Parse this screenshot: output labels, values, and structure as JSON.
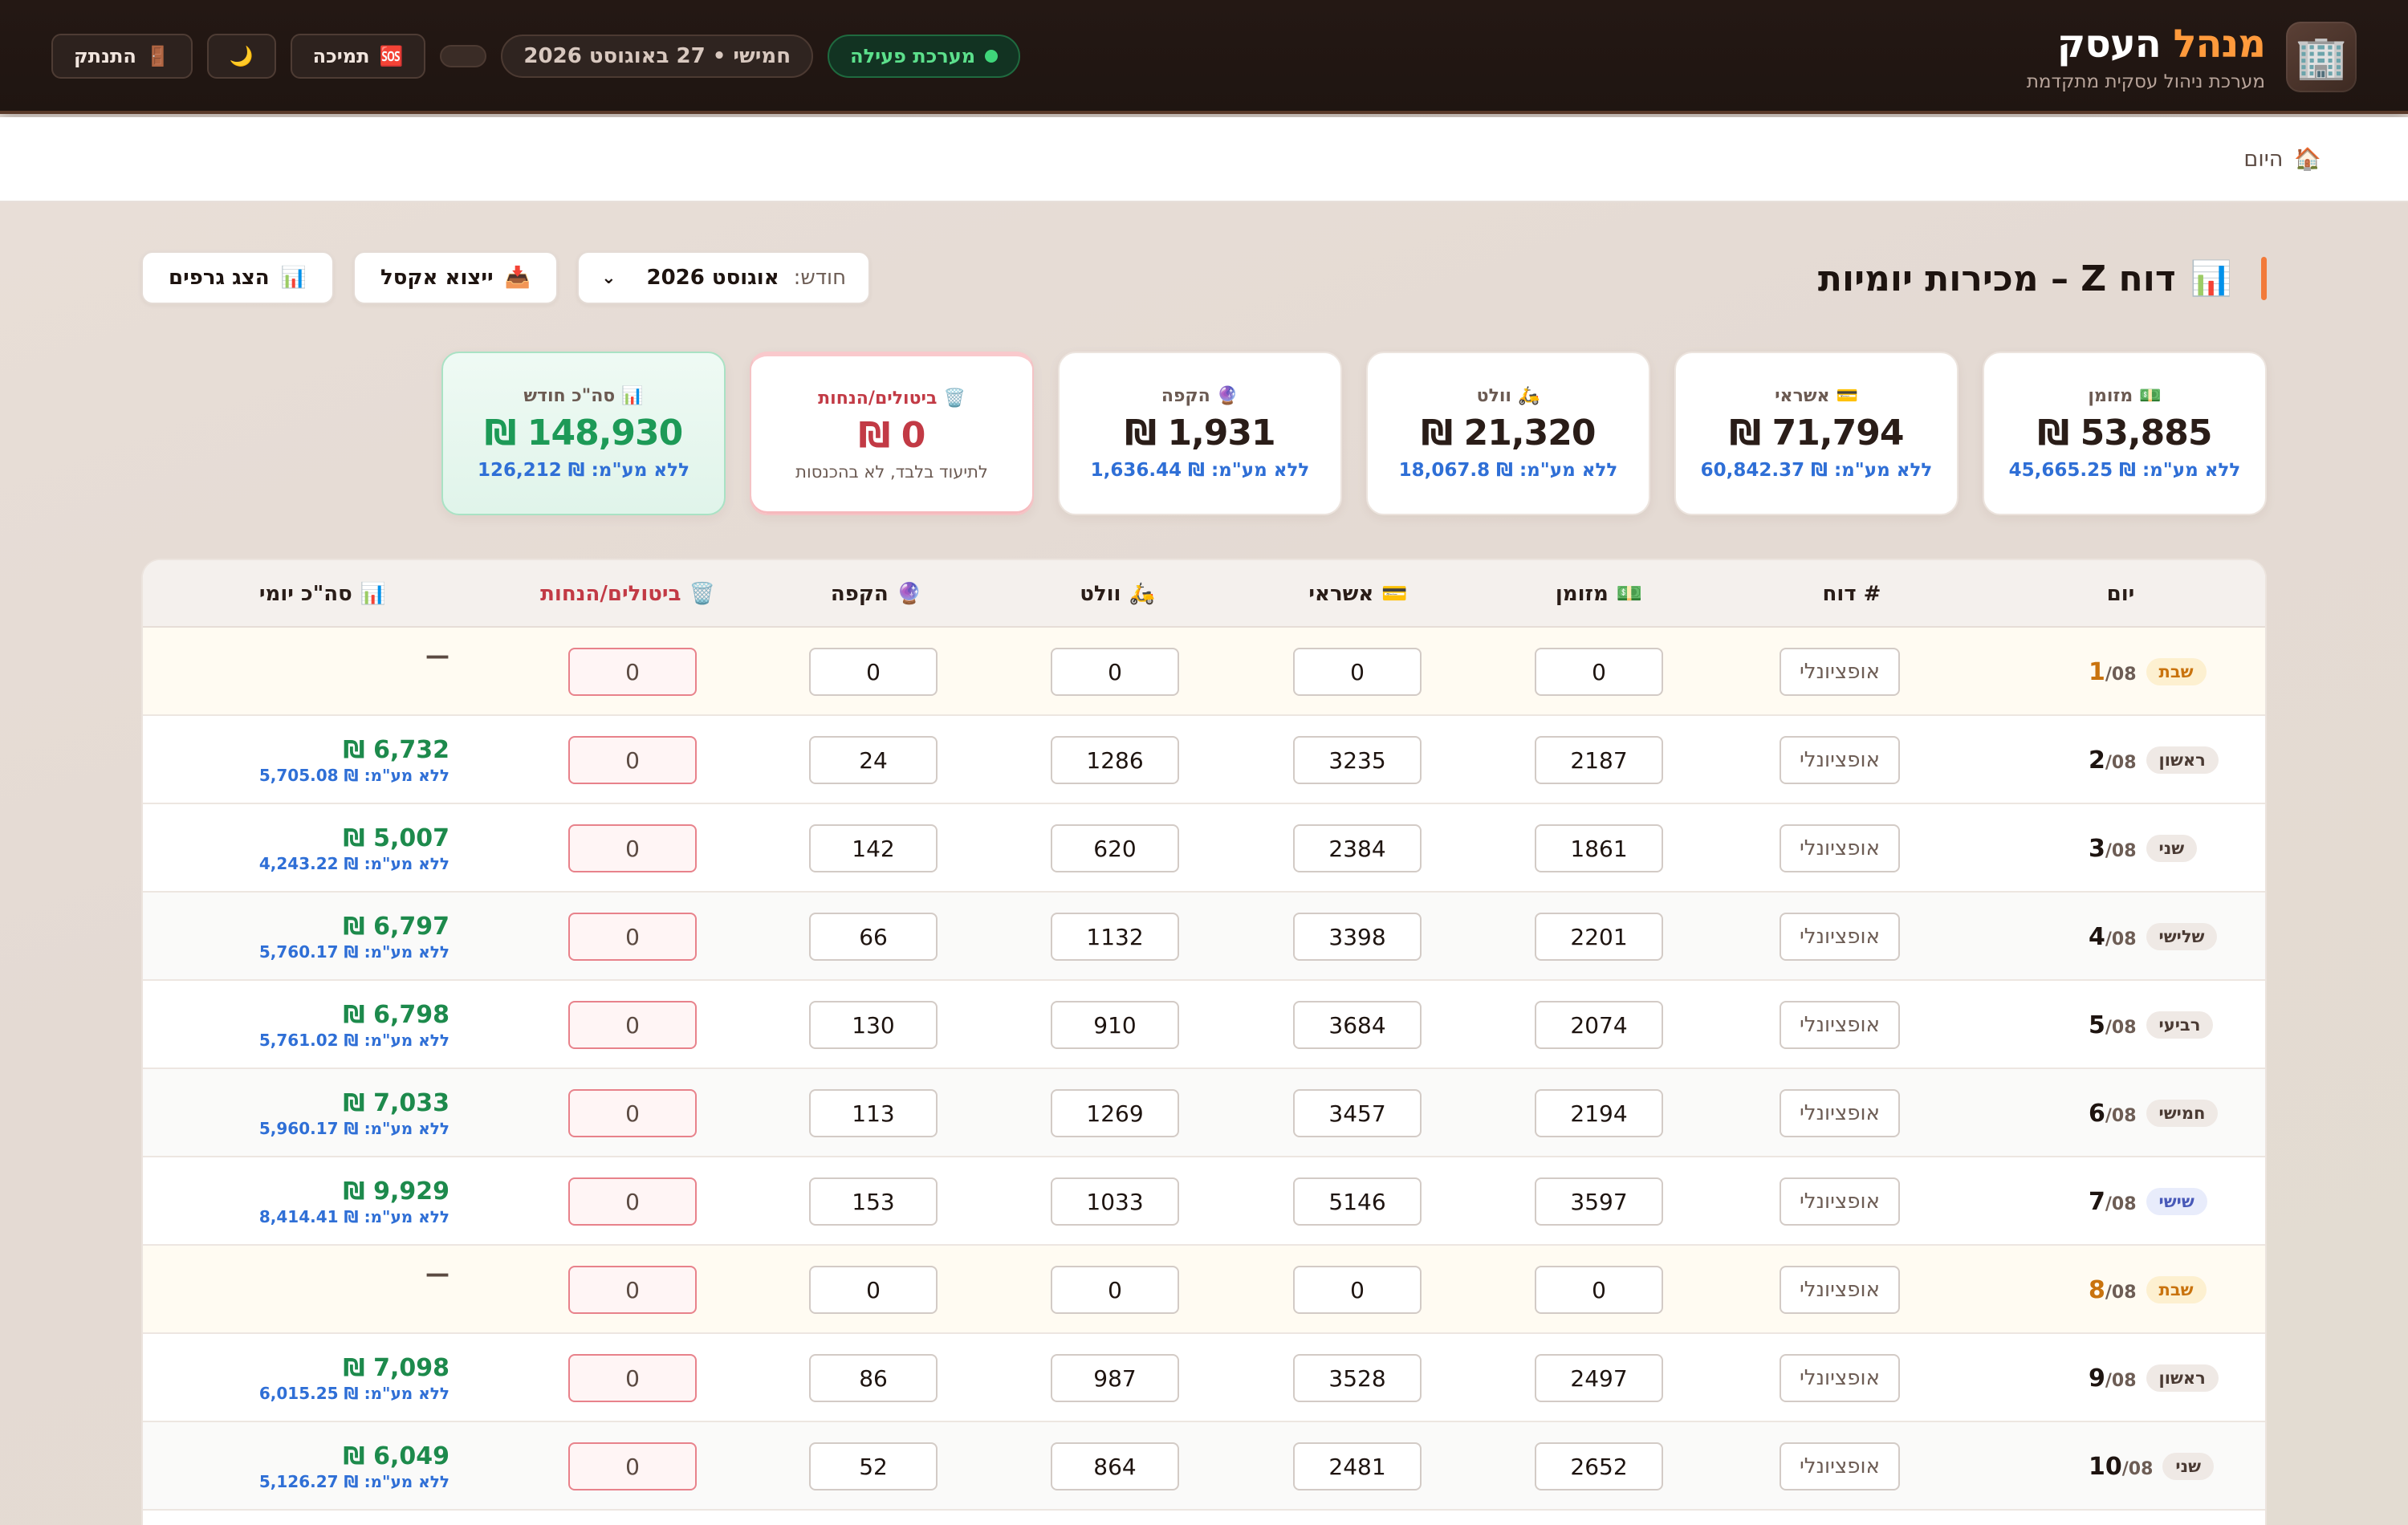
{
  "header": {
    "brand_title_main": "מנהל",
    "brand_title_rest": "העסק",
    "brand_subtitle": "מערכת ניהול עסקית מתקדמת",
    "status_label": "מערכת פעילה",
    "date_label": "חמישי • 27 באוגוסט 2026",
    "support_label": "תמיכה",
    "logout_label": "התנתק"
  },
  "breadcrumb": {
    "home_label": "היום"
  },
  "page": {
    "title": "דוח Z – מכירות יומיות",
    "month_label": "חודש:",
    "month_value": "אוגוסט 2026",
    "export_label": "ייצוא אקסל",
    "charts_label": "הצג גרפים"
  },
  "cards": [
    {
      "title": "מזומן",
      "icon": "💵",
      "value": "53,885 ₪",
      "sub": "ללא מע\"מ: ₪ 45,665.25"
    },
    {
      "title": "אשראי",
      "icon": "💳",
      "value": "71,794 ₪",
      "sub": "ללא מע\"מ: ₪ 60,842.37"
    },
    {
      "title": "וולט",
      "icon": "🛵",
      "value": "21,320 ₪",
      "sub": "ללא מע\"מ: ₪ 18,067.8"
    },
    {
      "title": "הקפה",
      "icon": "🔮",
      "value": "1,931 ₪",
      "sub": "ללא מע\"מ: ₪ 1,636.44"
    },
    {
      "title": "ביטולים/הנחות",
      "icon": "🗑️",
      "value": "0 ₪",
      "sub": "לתיעוד בלבד, לא בהכנסות"
    },
    {
      "title": "סה\"כ חודש",
      "icon": "📊",
      "value": "148,930 ₪",
      "sub": "ללא מע\"מ: ₪ 126,212"
    }
  ],
  "table": {
    "headers": {
      "day": "יום",
      "report": "# דוח",
      "cash": "מזומן",
      "credit": "אשראי",
      "wolt": "וולט",
      "tab": "הקפה",
      "cancel": "ביטולים/הנחות",
      "daily": "סה\"כ יומי"
    },
    "report_placeholder": "אופציונלי",
    "rows": [
      {
        "day": "1",
        "month": "/08",
        "weekday": "שבת",
        "type": "sat",
        "cash": "0",
        "credit": "0",
        "wolt": "0",
        "tab": "0",
        "cancel": "0",
        "daily": "",
        "daily_net": "",
        "dash": "—"
      },
      {
        "day": "2",
        "month": "/08",
        "weekday": "ראשון",
        "type": "",
        "cash": "2187",
        "credit": "3235",
        "wolt": "1286",
        "tab": "24",
        "cancel": "0",
        "daily": "6,732 ₪",
        "daily_net": "ללא מע\"מ: ₪ 5,705.08",
        "dash": ""
      },
      {
        "day": "3",
        "month": "/08",
        "weekday": "שני",
        "type": "",
        "cash": "1861",
        "credit": "2384",
        "wolt": "620",
        "tab": "142",
        "cancel": "0",
        "daily": "5,007 ₪",
        "daily_net": "ללא מע\"מ: ₪ 4,243.22",
        "dash": ""
      },
      {
        "day": "4",
        "month": "/08",
        "weekday": "שלישי",
        "type": "alt",
        "cash": "2201",
        "credit": "3398",
        "wolt": "1132",
        "tab": "66",
        "cancel": "0",
        "daily": "6,797 ₪",
        "daily_net": "ללא מע\"מ: ₪ 5,760.17",
        "dash": ""
      },
      {
        "day": "5",
        "month": "/08",
        "weekday": "רביעי",
        "type": "",
        "cash": "2074",
        "credit": "3684",
        "wolt": "910",
        "tab": "130",
        "cancel": "0",
        "daily": "6,798 ₪",
        "daily_net": "ללא מע\"מ: ₪ 5,761.02",
        "dash": ""
      },
      {
        "day": "6",
        "month": "/08",
        "weekday": "חמישי",
        "type": "alt",
        "cash": "2194",
        "credit": "3457",
        "wolt": "1269",
        "tab": "113",
        "cancel": "0",
        "daily": "7,033 ₪",
        "daily_net": "ללא מע\"מ: ₪ 5,960.17",
        "dash": ""
      },
      {
        "day": "7",
        "month": "/08",
        "weekday": "שישי",
        "type": "fri",
        "cash": "3597",
        "credit": "5146",
        "wolt": "1033",
        "tab": "153",
        "cancel": "0",
        "daily": "9,929 ₪",
        "daily_net": "ללא מע\"מ: ₪ 8,414.41",
        "dash": ""
      },
      {
        "day": "8",
        "month": "/08",
        "weekday": "שבת",
        "type": "sat",
        "cash": "0",
        "credit": "0",
        "wolt": "0",
        "tab": "0",
        "cancel": "0",
        "daily": "",
        "daily_net": "",
        "dash": "—"
      },
      {
        "day": "9",
        "month": "/08",
        "weekday": "ראשון",
        "type": "",
        "cash": "2497",
        "credit": "3528",
        "wolt": "987",
        "tab": "86",
        "cancel": "0",
        "daily": "7,098 ₪",
        "daily_net": "ללא מע\"מ: ₪ 6,015.25",
        "dash": ""
      },
      {
        "day": "10",
        "month": "/08",
        "weekday": "שני",
        "type": "alt",
        "cash": "2652",
        "credit": "2481",
        "wolt": "864",
        "tab": "52",
        "cancel": "0",
        "daily": "6,049 ₪",
        "daily_net": "ללא מע\"מ: ₪ 5,126.27",
        "dash": ""
      }
    ]
  }
}
